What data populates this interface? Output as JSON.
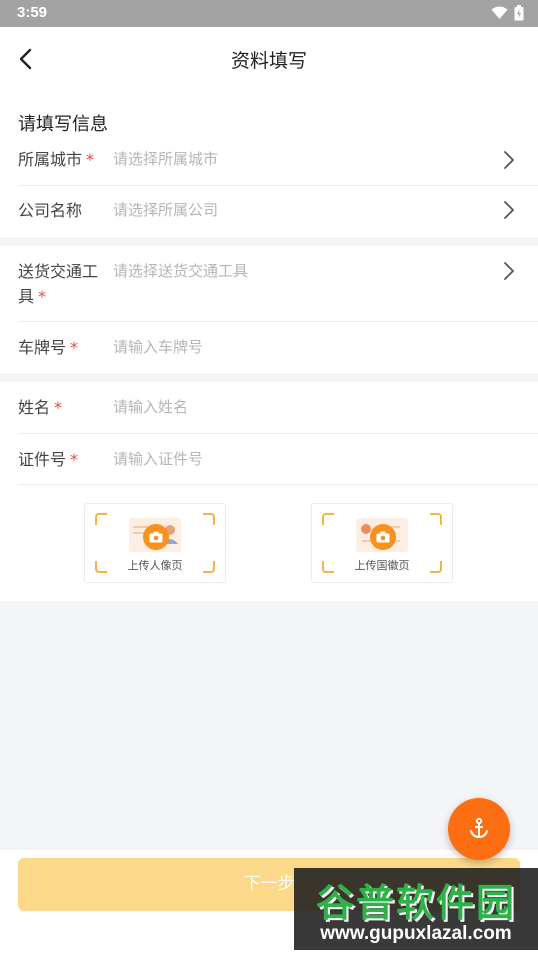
{
  "status_bar": {
    "time": "3:59"
  },
  "nav": {
    "title": "资料填写"
  },
  "section_title": "请填写信息",
  "required_mark": "*",
  "form": {
    "city": {
      "label": "所属城市",
      "placeholder": "请选择所属城市",
      "required": true
    },
    "company": {
      "label": "公司名称",
      "placeholder": "请选择所属公司",
      "required": false
    },
    "vehicle": {
      "label_line1": "送货交通工",
      "label_line2": "具",
      "placeholder": "请选择送货交通工具",
      "required": true
    },
    "plate": {
      "label": "车牌号",
      "placeholder": "请输入车牌号",
      "required": true
    },
    "name": {
      "label": "姓名",
      "placeholder": "请输入姓名",
      "required": true
    },
    "id_number": {
      "label": "证件号",
      "placeholder": "请输入证件号",
      "required": true
    }
  },
  "uploads": [
    {
      "label": "上传人像页",
      "icon": "camera-icon"
    },
    {
      "label": "上传国徽页",
      "icon": "camera-icon"
    }
  ],
  "next_button": {
    "label": "下一步"
  },
  "fab_icon": "anchor-icon",
  "watermark": {
    "main": "谷普软件园",
    "url": "www.gupuxlazal.com"
  },
  "colors": {
    "accent": "#f6921e",
    "fab": "#fd6d12",
    "required": "#f04a3e",
    "button_disabled": "#fcd98a"
  }
}
